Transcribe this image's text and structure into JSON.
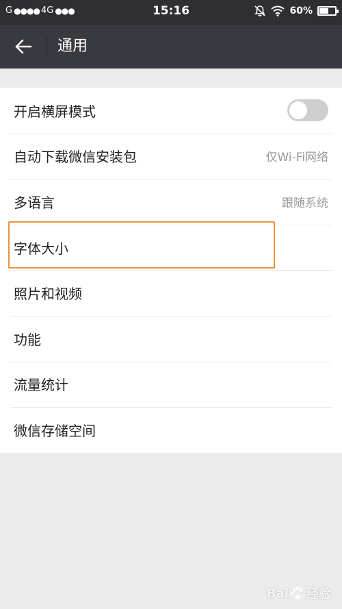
{
  "status_bar": {
    "carrier": "G",
    "network": "4G",
    "time": "15:16",
    "battery": "60%",
    "battery_level": 0.6,
    "icons": [
      "signal-dots-icon",
      "mute-bell-icon",
      "wifi-icon",
      "battery-icon"
    ]
  },
  "nav": {
    "title": "通用",
    "back_icon": "back-arrow-icon"
  },
  "settings": {
    "items": [
      {
        "label": "开启横屏模式"
      },
      {
        "label": "自动下载微信安装包",
        "value": "仅Wi-Fi网络"
      },
      {
        "label": "多语言",
        "value": "跟随系统"
      },
      {
        "label": "字体大小"
      },
      {
        "label": "照片和视频"
      },
      {
        "label": "功能"
      },
      {
        "label": "流量统计"
      },
      {
        "label": "微信存储空间"
      }
    ],
    "landscape_toggle_on": false
  },
  "watermark": {
    "left": "Bai",
    "right": "经验"
  },
  "colors": {
    "status_bar_bg": "#2f2f33",
    "nav_bg": "#393a3f",
    "page_bg": "#ebebeb",
    "highlight_border": "#e8943a",
    "toggle_off": "#cfcfcf"
  }
}
